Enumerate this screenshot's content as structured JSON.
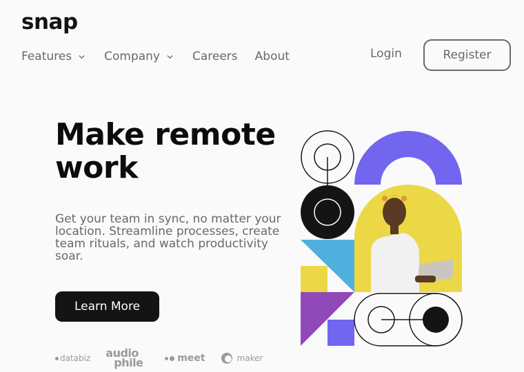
{
  "brand": {
    "logo_text": "snap"
  },
  "nav": {
    "items": [
      {
        "label": "Features",
        "has_dropdown": true
      },
      {
        "label": "Company",
        "has_dropdown": true
      },
      {
        "label": "Careers",
        "has_dropdown": false
      },
      {
        "label": "About",
        "has_dropdown": false
      }
    ],
    "login_label": "Login",
    "register_label": "Register"
  },
  "hero": {
    "headline": "Make remote work",
    "subtext": "Get your team in sync, no matter your location. Streamline processes, create team rituals, and watch productivity soar.",
    "cta_label": "Learn More"
  },
  "clients": {
    "databiz": "databiz",
    "audiophile_line1": "audio",
    "audiophile_line2": "phile",
    "meet": "meet",
    "maker": "maker"
  },
  "colors": {
    "purple": "#7266f0",
    "yellow": "#ecd846",
    "blue": "#4fb0dd",
    "violet": "#9049b8",
    "dark": "#141414",
    "gray": "#686868"
  }
}
